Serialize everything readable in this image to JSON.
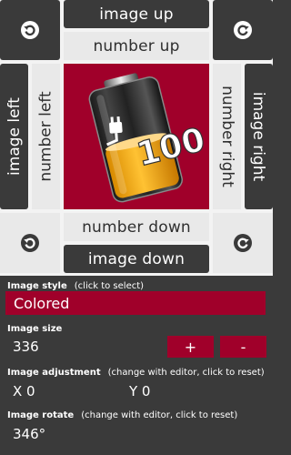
{
  "controls": {
    "image_up": "image up",
    "number_up": "number up",
    "image_left": "image left",
    "number_left": "number left",
    "number_right": "number right",
    "image_right": "image right",
    "number_down": "number down",
    "image_down": "image down"
  },
  "preview": {
    "badge_text": "100",
    "background_color": "#a0002a"
  },
  "icons": {
    "rotate_ccw": "rotate-ccw-icon",
    "rotate_cw": "rotate-cw-icon",
    "battery": "battery-charging-icon"
  },
  "settings": {
    "image_style": {
      "title": "Image style",
      "hint": "(click to select)",
      "value": "Colored"
    },
    "image_size": {
      "title": "Image size",
      "value": "336",
      "plus_label": "+",
      "minus_label": "-"
    },
    "image_adjustment": {
      "title": "Image adjustment",
      "hint": "(change with editor, click to reset)",
      "x_value": "X 0",
      "y_value": "Y 0"
    },
    "image_rotate": {
      "title": "Image rotate",
      "hint": "(change with editor, click to reset)",
      "value": "346°"
    }
  },
  "colors": {
    "accent": "#a0002a",
    "dark_tile": "#3a3a3a",
    "light_tile": "#e9e9e9"
  }
}
